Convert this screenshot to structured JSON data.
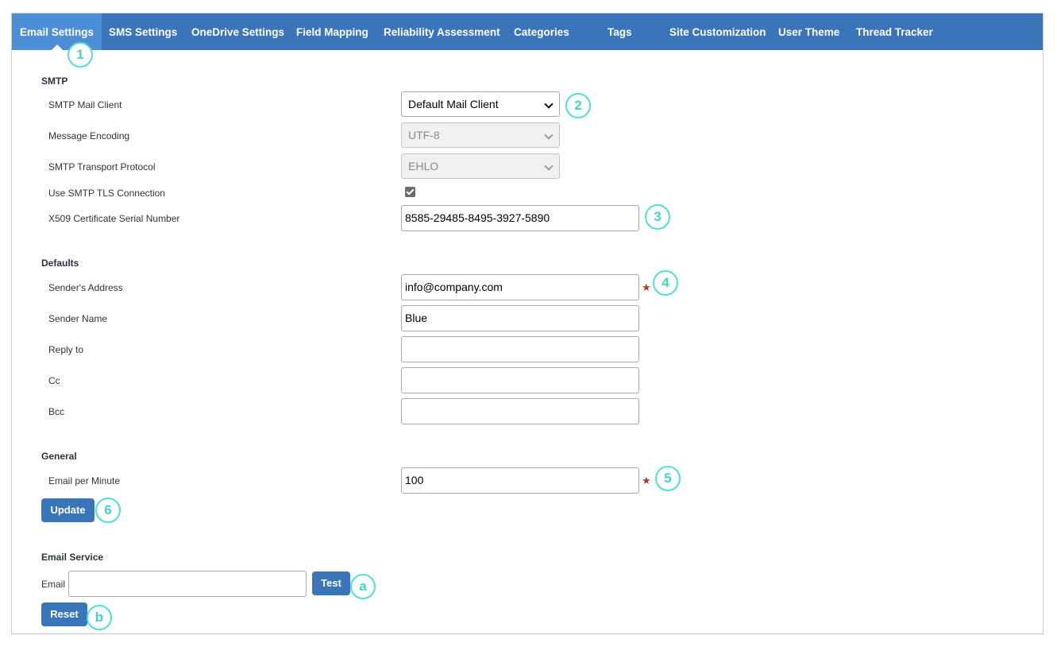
{
  "tabs": [
    {
      "label": "Email Settings",
      "active": true
    },
    {
      "label": "SMS Settings"
    },
    {
      "label": "OneDrive Settings"
    },
    {
      "label": "Field Mapping"
    },
    {
      "label": "Reliability Assessment"
    },
    {
      "label": "Categories"
    },
    {
      "label": "Tags"
    },
    {
      "label": "Site Customization"
    },
    {
      "label": "User Theme"
    },
    {
      "label": "Thread Tracker"
    }
  ],
  "smtp": {
    "title": "SMTP",
    "mail_client_label": "SMTP Mail Client",
    "mail_client_value": "Default Mail Client",
    "encoding_label": "Message Encoding",
    "encoding_value": "UTF-8",
    "transport_label": "SMTP Transport Protocol",
    "transport_value": "EHLO",
    "tls_label": "Use SMTP TLS Connection",
    "tls_checked": true,
    "x509_label": "X509 Certificate Serial Number",
    "x509_value": "8585-29485-8495-3927-5890"
  },
  "defaults": {
    "title": "Defaults",
    "sender_address_label": "Sender's Address",
    "sender_address_value": "info@company.com",
    "sender_name_label": "Sender Name",
    "sender_name_value": "Blue",
    "reply_to_label": "Reply to",
    "reply_to_value": "",
    "cc_label": "Cc",
    "cc_value": "",
    "bcc_label": "Bcc",
    "bcc_value": ""
  },
  "general": {
    "title": "General",
    "email_per_minute_label": "Email per Minute",
    "email_per_minute_value": "100",
    "update_label": "Update"
  },
  "email_service": {
    "title": "Email Service",
    "email_label": "Email",
    "email_value": "",
    "test_label": "Test",
    "reset_label": "Reset"
  },
  "required_mark": "★",
  "badges": [
    "1",
    "2",
    "3",
    "4",
    "5",
    "6",
    "a",
    "b"
  ],
  "colors": {
    "tab_bar": "#3a75ba",
    "tab_active": "#4d8fd6",
    "button": "#3a75ba",
    "badge": "#4fe0cf",
    "required_star": "#b5381b"
  }
}
